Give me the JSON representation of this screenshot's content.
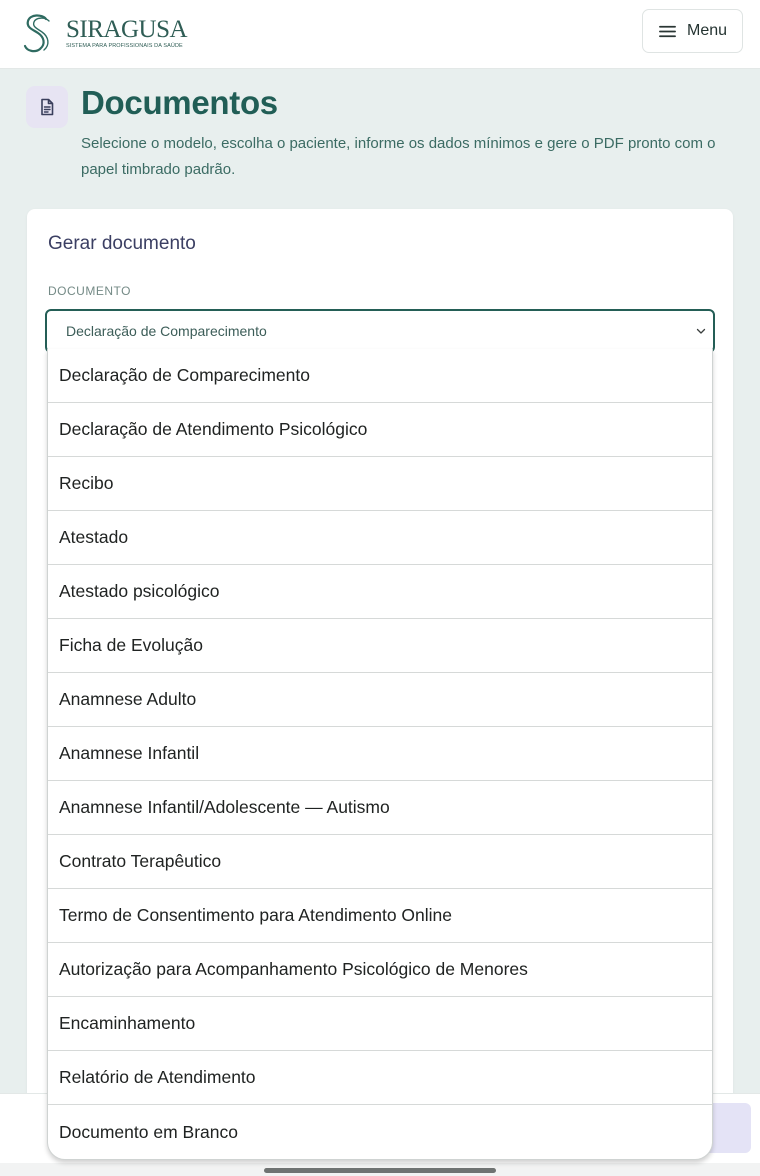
{
  "header": {
    "logo_name": "SIRAGUSA",
    "logo_tagline": "SISTEMA PARA PROFISSIONAIS DA SAÚDE",
    "menu_label": "Menu",
    "menu_icon": "hamburger-icon"
  },
  "page": {
    "icon": "document-icon",
    "title": "Documentos",
    "subtitle": "Selecione o modelo, escolha o paciente, informe os dados mínimos e gere o PDF pronto com o papel timbrado padrão."
  },
  "form": {
    "card_title": "Gerar documento",
    "document_label": "DOCUMENTO",
    "document_selected": "Declaração de Comparecimento",
    "document_options": [
      "Declaração de Comparecimento",
      "Declaração de Atendimento Psicológico",
      "Recibo",
      "Atestado",
      "Atestado psicológico",
      "Ficha de Evolução",
      "Anamnese Adulto",
      "Anamnese Infantil",
      "Anamnese Infantil/Adolescente — Autismo",
      "Contrato Terapêutico",
      "Termo de Consentimento para Atendimento Online",
      "Autorização para Acompanhamento Psicológico de Menores",
      "Encaminhamento",
      "Relatório de Atendimento",
      "Documento em Branco"
    ]
  },
  "colors": {
    "brand": "#215e56",
    "page_background": "#e8efee",
    "icon_badge": "#e7e4f3",
    "card_title": "#3b3f63"
  }
}
